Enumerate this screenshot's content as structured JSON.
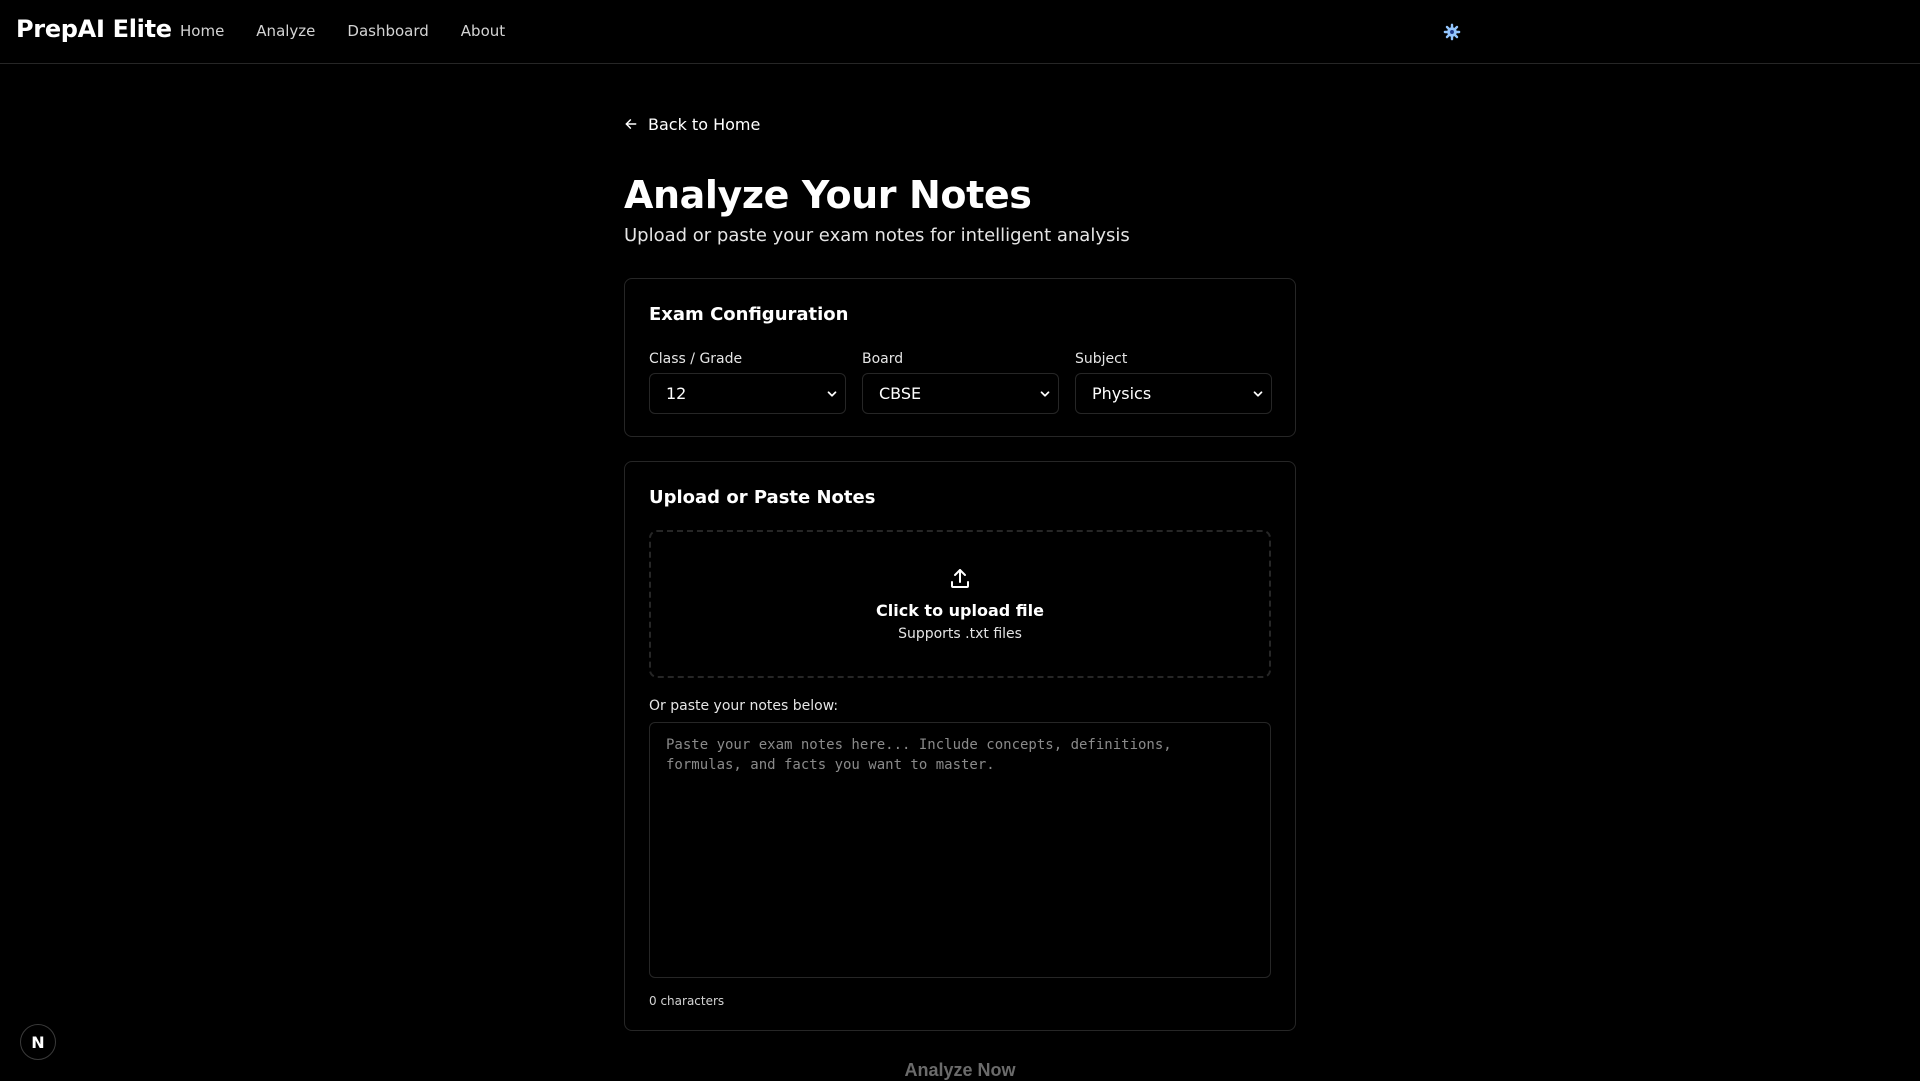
{
  "app": {
    "brand": "PrepAI Elite"
  },
  "nav": {
    "items": [
      {
        "label": "Home"
      },
      {
        "label": "Analyze"
      },
      {
        "label": "Dashboard"
      },
      {
        "label": "About"
      }
    ],
    "settings_icon": "gear-icon"
  },
  "page": {
    "back_label": "Back to Home",
    "title": "Analyze Your Notes",
    "subtitle": "Upload or paste your exam notes for intelligent analysis"
  },
  "config": {
    "title": "Exam Configuration",
    "class_label": "Class / Grade",
    "class_value": "12",
    "board_label": "Board",
    "board_value": "CBSE",
    "subject_label": "Subject",
    "subject_value": "Physics"
  },
  "notes": {
    "title": "Upload or Paste Notes",
    "upload_title": "Click to upload file",
    "upload_sub": "Supports .txt files",
    "paste_label": "Or paste your notes below:",
    "placeholder": "Paste your exam notes here... Include concepts, definitions, formulas, and facts you want to master.",
    "char_count": "0 characters"
  },
  "actions": {
    "analyze_label": "Analyze Now"
  },
  "dev_badge": {
    "label": "N"
  },
  "colors": {
    "background": "#000000",
    "border": "#262626",
    "accent": "#93c5fd",
    "disabled_text": "#6b6b6b"
  }
}
